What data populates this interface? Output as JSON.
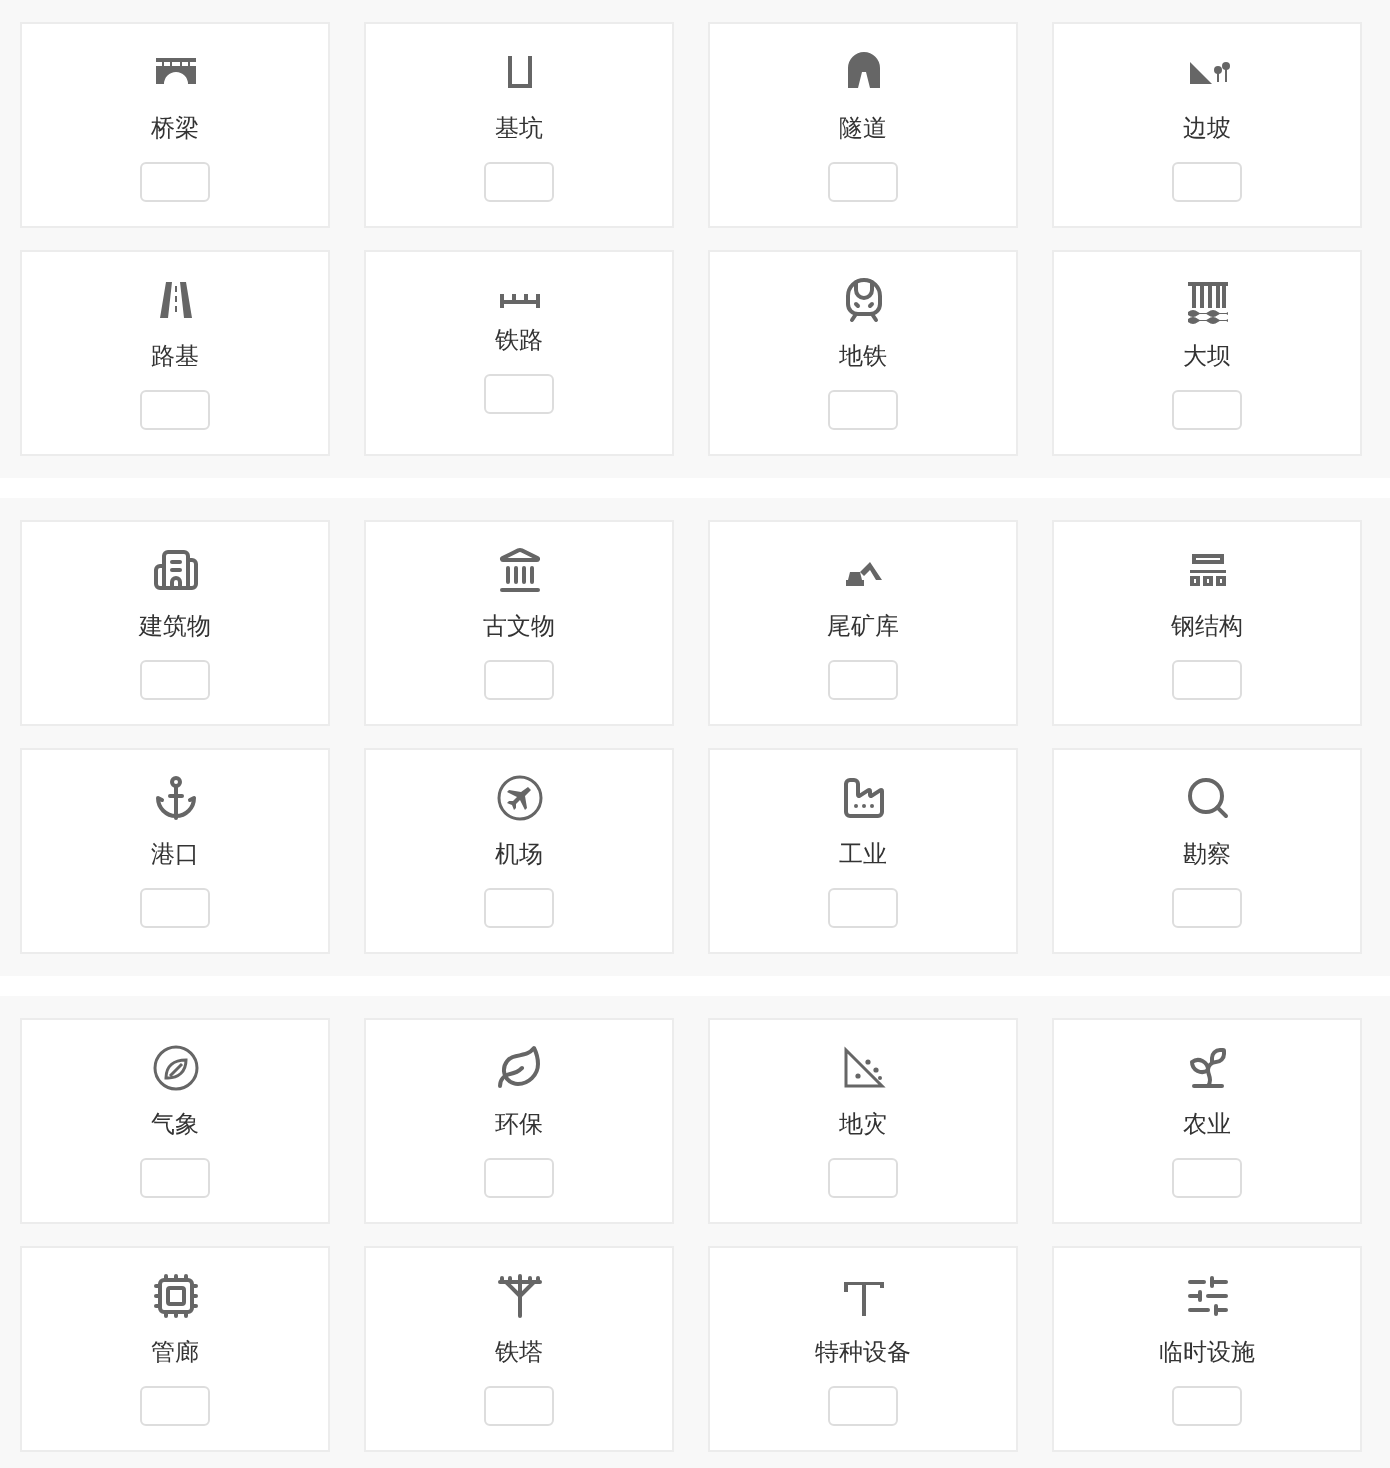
{
  "sections": [
    {
      "cards": [
        {
          "kind": "bridge",
          "label": "桥梁"
        },
        {
          "kind": "pit",
          "label": "基坑"
        },
        {
          "kind": "tunnel",
          "label": "隧道"
        },
        {
          "kind": "slope",
          "label": "边坡"
        },
        {
          "kind": "road",
          "label": "路基"
        },
        {
          "kind": "railway",
          "label": "铁路"
        },
        {
          "kind": "metro",
          "label": "地铁"
        },
        {
          "kind": "dam",
          "label": "大坝"
        }
      ]
    },
    {
      "cards": [
        {
          "kind": "building",
          "label": "建筑物"
        },
        {
          "kind": "heritage",
          "label": "古文物"
        },
        {
          "kind": "tailings",
          "label": "尾矿库"
        },
        {
          "kind": "steel",
          "label": "钢结构"
        },
        {
          "kind": "port",
          "label": "港口"
        },
        {
          "kind": "airport",
          "label": "机场"
        },
        {
          "kind": "industry",
          "label": "工业"
        },
        {
          "kind": "survey",
          "label": "勘察"
        }
      ]
    },
    {
      "cards": [
        {
          "kind": "weather",
          "label": "气象"
        },
        {
          "kind": "environment",
          "label": "环保"
        },
        {
          "kind": "hazard",
          "label": "地灾"
        },
        {
          "kind": "agriculture",
          "label": "农业"
        },
        {
          "kind": "corridor",
          "label": "管廊"
        },
        {
          "kind": "tower",
          "label": "铁塔"
        },
        {
          "kind": "equipment",
          "label": "特种设备"
        },
        {
          "kind": "temporary",
          "label": "临时设施"
        }
      ]
    }
  ]
}
